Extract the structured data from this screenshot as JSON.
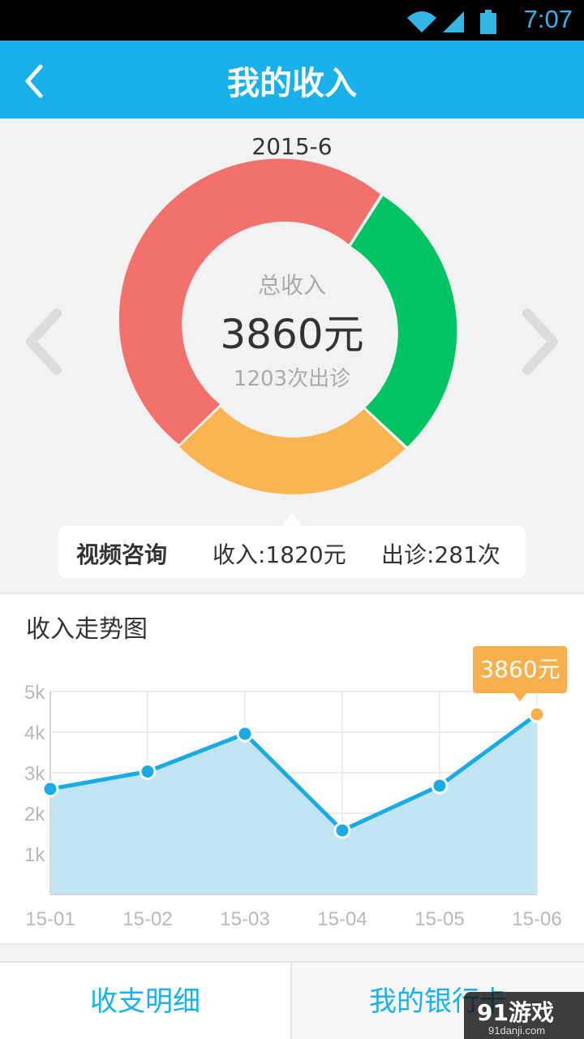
{
  "status_bar": {
    "time": "7:07",
    "icons": [
      "wifi-icon",
      "signal-icon",
      "battery-icon"
    ]
  },
  "app_bar": {
    "title": "我的收入",
    "back_icon": "back-chevron-icon"
  },
  "summary": {
    "month": "2015-6",
    "total_label": "总收入",
    "total_value": "3860元",
    "visits_text": "1203次出诊",
    "selected": {
      "category": "视频咨询",
      "income_text": "收入:1820元",
      "visits_text": "出诊:281次"
    },
    "colors": {
      "red": "#f2716c",
      "green": "#00c463",
      "orange": "#f8b551"
    }
  },
  "trend": {
    "title": "收入走势图",
    "tooltip": "3860元",
    "colors": {
      "line": "#1aaae6",
      "fill": "#bfe4f6",
      "highlight": "#f8b04e"
    }
  },
  "chart_data": {
    "type": "area",
    "title": "",
    "xlabel": "",
    "ylabel": "",
    "categories": [
      "15-01",
      "15-02",
      "15-03",
      "15-04",
      "15-05",
      "15-06"
    ],
    "values": [
      2600,
      3030,
      3960,
      1580,
      2680,
      4440
    ],
    "y_ticks": [
      "1k",
      "2k",
      "3k",
      "4k",
      "5k"
    ],
    "ylim": [
      0,
      5000
    ],
    "grid": true,
    "highlight_index": 5
  },
  "bottom_tabs": {
    "left": "收支明细",
    "right": "我的银行卡"
  },
  "watermark": {
    "main": "91游戏",
    "sub": "91danji.com"
  }
}
